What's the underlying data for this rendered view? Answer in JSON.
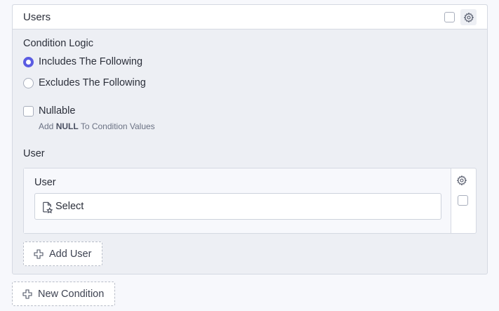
{
  "panel": {
    "title": "Users",
    "header_icons": [
      "checkbox",
      "gear-icon"
    ]
  },
  "condition_logic": {
    "label": "Condition Logic",
    "options": [
      {
        "label": "Includes The Following",
        "selected": true
      },
      {
        "label": "Excludes The Following",
        "selected": false
      }
    ]
  },
  "nullable": {
    "label": "Nullable",
    "checked": false,
    "hint_prefix": "Add",
    "hint_strong": "NULL",
    "hint_suffix": "To Condition Values"
  },
  "user_section": {
    "label": "User",
    "field_label": "User",
    "select_placeholder": "Select",
    "select_icon": "document-star-icon",
    "side_icons": [
      "gear-icon",
      "checkbox"
    ]
  },
  "buttons": {
    "add_user": "Add User",
    "new_condition": "New Condition",
    "icon": "plus-outline-icon"
  },
  "colors": {
    "accent": "#5b5ce2",
    "panel_bg": "#edeff4",
    "page_bg": "#f7f8fc",
    "border": "#d5d9e2"
  }
}
